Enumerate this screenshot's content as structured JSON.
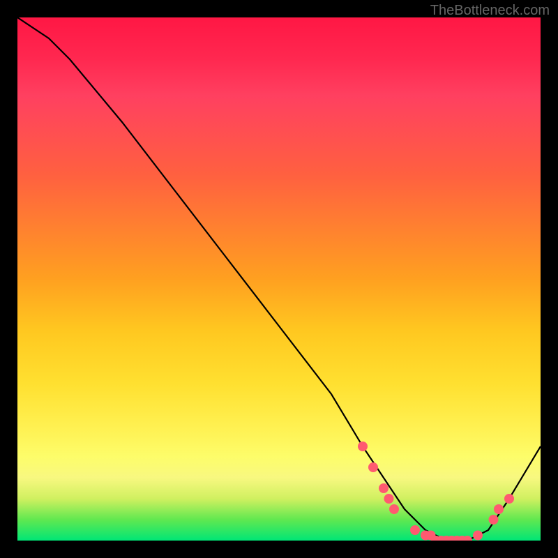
{
  "watermark": "TheBottleneck.com",
  "chart_data": {
    "type": "line",
    "title": "",
    "xlabel": "",
    "ylabel": "",
    "xlim": [
      0,
      100
    ],
    "ylim": [
      0,
      100
    ],
    "background": "rainbow-gradient-vertical",
    "series": [
      {
        "name": "bottleneck-curve",
        "color": "#000000",
        "x": [
          0,
          6,
          10,
          20,
          30,
          40,
          50,
          60,
          66,
          70,
          74,
          78,
          82,
          86,
          90,
          94,
          100
        ],
        "values": [
          100,
          96,
          92,
          80,
          67,
          54,
          41,
          28,
          18,
          12,
          6,
          2,
          0,
          0,
          2,
          8,
          18
        ]
      }
    ],
    "markers": [
      {
        "name": "highlight-dots",
        "color": "#ff5a70",
        "radius": 7,
        "points": [
          {
            "x": 66,
            "y": 18
          },
          {
            "x": 68,
            "y": 14
          },
          {
            "x": 70,
            "y": 10
          },
          {
            "x": 71,
            "y": 8
          },
          {
            "x": 72,
            "y": 6
          },
          {
            "x": 76,
            "y": 2
          },
          {
            "x": 78,
            "y": 1
          },
          {
            "x": 79,
            "y": 1
          },
          {
            "x": 80,
            "y": 0
          },
          {
            "x": 81,
            "y": 0
          },
          {
            "x": 82,
            "y": 0
          },
          {
            "x": 83,
            "y": 0
          },
          {
            "x": 84,
            "y": 0
          },
          {
            "x": 85,
            "y": 0
          },
          {
            "x": 86,
            "y": 0
          },
          {
            "x": 88,
            "y": 1
          },
          {
            "x": 91,
            "y": 4
          },
          {
            "x": 92,
            "y": 6
          },
          {
            "x": 94,
            "y": 8
          }
        ]
      }
    ]
  }
}
